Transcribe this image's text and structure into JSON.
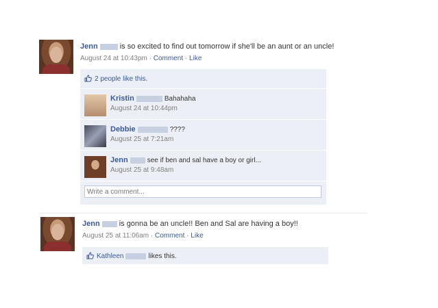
{
  "post1": {
    "author": "Jenn",
    "status": "is so excited to find out tomorrow if she'll be an aunt or an uncle!",
    "time": "August 24 at 10:43pm",
    "comment_link": "Comment",
    "like_link": "Like",
    "sep": "·",
    "likes": "2 people like this.",
    "comments": [
      {
        "author": "Kristin",
        "text": "Bahahaha",
        "time": "August 24 at 10:44pm"
      },
      {
        "author": "Debbie",
        "text": "????",
        "time": "August 25 at 7:21am"
      },
      {
        "author": "Jenn",
        "text": "see if ben and sal have a boy or girl...",
        "time": "August 25 at 9:48am"
      }
    ],
    "write_placeholder": "Write a comment..."
  },
  "post2": {
    "author": "Jenn",
    "status": "is gonna be an uncle!! Ben and Sal are having a boy!!",
    "time": "August 25 at 11:06am",
    "comment_link": "Comment",
    "like_link": "Like",
    "sep": "·",
    "liker": "Kathleen",
    "likes_suffix": "likes this."
  },
  "colors": {
    "link": "#3b5998",
    "ufi_bg": "#eceff5",
    "meta": "#808080"
  }
}
